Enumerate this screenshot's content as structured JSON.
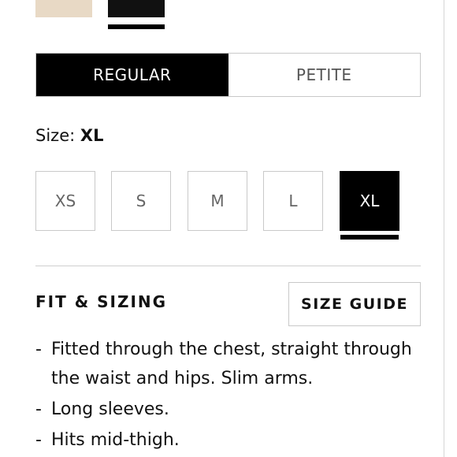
{
  "swatches": [
    {
      "name": "beige",
      "color": "#e8d9c5",
      "selected": false
    },
    {
      "name": "black",
      "color": "#111111",
      "selected": true
    }
  ],
  "fit": {
    "options": [
      "REGULAR",
      "PETITE"
    ],
    "selected": "REGULAR"
  },
  "size": {
    "label": "Size:",
    "selected": "XL",
    "options": [
      "XS",
      "S",
      "M",
      "L",
      "XL"
    ]
  },
  "fit_sizing": {
    "title": "FIT & SIZING",
    "size_guide_label": "SIZE GUIDE",
    "details": [
      "Fitted through the chest, straight through the waist and hips. Slim arms.",
      "Long sleeves.",
      "Hits mid-thigh."
    ]
  }
}
